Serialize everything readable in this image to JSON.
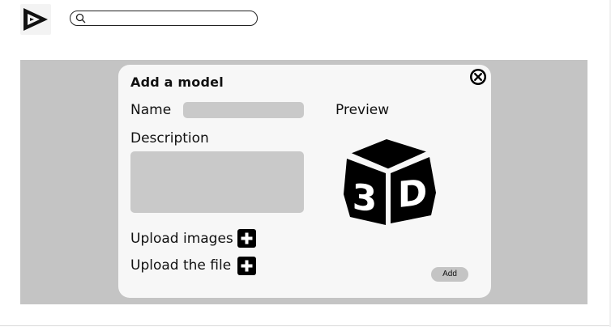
{
  "search": {
    "value": "",
    "placeholder": ""
  },
  "modal": {
    "title": "Add a model",
    "name_label": "Name",
    "name_value": "",
    "description_label": "Description",
    "description_value": "",
    "preview_label": "Preview",
    "preview_text": "3D",
    "upload_images_label": "Upload images",
    "upload_file_label": "Upload the file",
    "add_button_label": "Add"
  },
  "icons": {
    "logo": "play-triangle-logo-icon",
    "search": "search-icon",
    "close": "close-circle-icon",
    "upload_images": "plus-icon",
    "upload_file": "plus-icon",
    "preview": "3d-cube-icon"
  },
  "colors": {
    "backdrop": "#c4c4c4",
    "modal_background": "#f7f7f7",
    "field_background": "#c9c9c9",
    "icon_fill": "#000000"
  }
}
